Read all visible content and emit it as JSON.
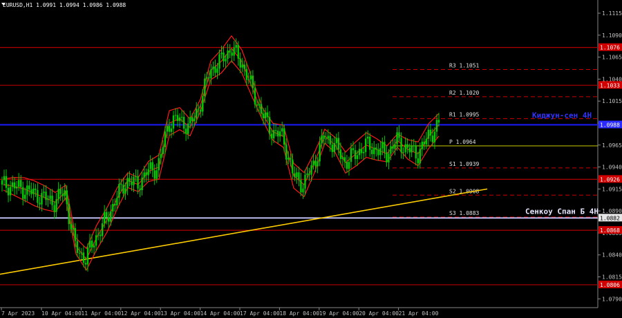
{
  "header": {
    "symbol_line": "EURUSD,H1  1.0991 1.0994 1.0986 1.0988"
  },
  "colors": {
    "background": "#000000",
    "candle": "#00cc00",
    "bollinger": "#ff1a1a",
    "levels_red": "#b00000",
    "kijun": "#1a1aff",
    "senkou": "#c8c8ff",
    "trendline": "#ffcc00",
    "pivot_lines": "#cc0000",
    "pivot_p": "#cccc00",
    "axis_text": "#c0c0c0",
    "grid": "#ffffff"
  },
  "price_axis": {
    "ticks": [
      "1.1115",
      "1.1090",
      "1.1065",
      "1.1040",
      "1.1015",
      "1.0990",
      "1.0965",
      "1.0940",
      "1.0915",
      "1.0890",
      "1.0865",
      "1.0840",
      "1.0815",
      "1.0790"
    ]
  },
  "time_axis": {
    "labels": [
      "7 Apr 2023",
      "10 Apr 04:00",
      "11 Apr 04:00",
      "12 Apr 04:00",
      "13 Apr 04:00",
      "14 Apr 04:00",
      "17 Apr 04:00",
      "18 Apr 04:00",
      "19 Apr 04:00",
      "20 Apr 04:00",
      "21 Apr 04:00"
    ]
  },
  "chart_data": {
    "type": "candlestick",
    "symbol": "EURUSD",
    "timeframe": "H1",
    "ohlc_last": {
      "open": 1.0991,
      "high": 1.0994,
      "low": 1.0986,
      "close": 1.0988
    },
    "ylim": [
      1.078,
      1.113
    ],
    "horizontal_levels": [
      {
        "value": 1.1076,
        "label": "1.1076"
      },
      {
        "value": 1.1033,
        "label": "1.1033"
      },
      {
        "value": 1.0926,
        "label": "1.0926"
      },
      {
        "value": 1.0868,
        "label": "1.0868"
      },
      {
        "value": 1.0806,
        "label": "1.0806"
      }
    ],
    "kijun": {
      "value": 1.0988,
      "label": "Киджун-сен 4H",
      "price_label": "1.0988"
    },
    "senkou": {
      "value": 1.0882,
      "label": "Сенкоу Спан Б 4H",
      "price_label": "1.0882"
    },
    "pivots": [
      {
        "name": "R3",
        "value": 1.1051,
        "label": "R3 1.1051"
      },
      {
        "name": "R2",
        "value": 1.102,
        "label": "R2 1.1020"
      },
      {
        "name": "R1",
        "value": 1.0995,
        "label": "R1 1.0995"
      },
      {
        "name": "P",
        "value": 1.0964,
        "label": "P 1.0964"
      },
      {
        "name": "S1",
        "value": 1.0939,
        "label": "S1 1.0939"
      },
      {
        "name": "S2",
        "value": 1.0908,
        "label": "S2 1.0908"
      },
      {
        "name": "S3",
        "value": 1.0883,
        "label": "S3 1.0883"
      }
    ],
    "trendline": {
      "from": {
        "t": "7 Apr 2023",
        "price": 1.0818
      },
      "to": {
        "t": "21 Apr 2023",
        "price": 1.0915
      }
    },
    "close_path": [
      [
        0,
        1.092
      ],
      [
        1,
        1.0918
      ],
      [
        2,
        1.0915
      ],
      [
        3,
        1.091
      ],
      [
        4,
        1.0905
      ],
      [
        5,
        1.09
      ],
      [
        6,
        1.0912
      ],
      [
        7,
        1.085
      ],
      [
        8,
        1.0835
      ],
      [
        9,
        1.086
      ],
      [
        10,
        1.088
      ],
      [
        11,
        1.0905
      ],
      [
        12,
        1.0925
      ],
      [
        13,
        1.092
      ],
      [
        14,
        1.0935
      ],
      [
        15,
        1.094
      ],
      [
        16,
        1.099
      ],
      [
        17,
        1.0995
      ],
      [
        18,
        1.0985
      ],
      [
        19,
        1.101
      ],
      [
        20,
        1.105
      ],
      [
        21,
        1.106
      ],
      [
        22,
        1.1075
      ],
      [
        23,
        1.106
      ],
      [
        24,
        1.103
      ],
      [
        25,
        1.1
      ],
      [
        26,
        1.098
      ],
      [
        27,
        1.0975
      ],
      [
        28,
        1.093
      ],
      [
        29,
        1.092
      ],
      [
        30,
        1.0945
      ],
      [
        31,
        1.0975
      ],
      [
        32,
        1.0965
      ],
      [
        33,
        1.0945
      ],
      [
        34,
        1.0955
      ],
      [
        35,
        1.0965
      ],
      [
        36,
        1.096
      ],
      [
        37,
        1.0955
      ],
      [
        38,
        1.097
      ],
      [
        39,
        1.096
      ],
      [
        40,
        1.0955
      ],
      [
        41,
        1.0975
      ],
      [
        42,
        1.0988
      ]
    ]
  }
}
